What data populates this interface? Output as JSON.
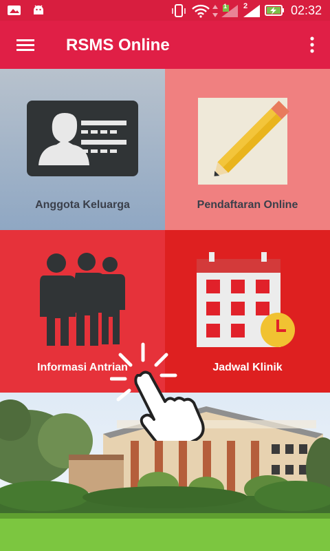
{
  "status_bar": {
    "time": "02:32",
    "sim_1": "1",
    "sim_2": "2"
  },
  "app_bar": {
    "title": "RSMS Online",
    "menu_icon": "hamburger-menu-icon",
    "more_icon": "more-vert-icon"
  },
  "menu": {
    "items": [
      {
        "label": "Anggota Keluarga",
        "icon": "id-card-icon"
      },
      {
        "label": "Pendaftaran Online",
        "icon": "pencil-note-icon"
      },
      {
        "label": "Informasi Antrian",
        "icon": "queue-people-icon"
      },
      {
        "label": "Jadwal Klinik",
        "icon": "calendar-clock-icon"
      }
    ]
  },
  "colors": {
    "primary": "#e01f46",
    "status_bar": "#d81e3f",
    "tile_2": "#f08080",
    "tile_3": "#e6323a",
    "tile_4": "#de2020"
  }
}
